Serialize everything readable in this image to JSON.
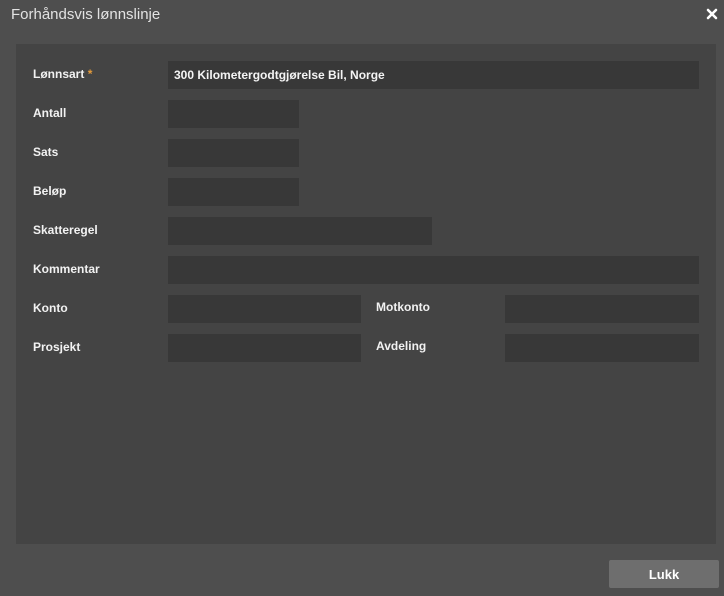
{
  "dialog": {
    "title": "Forhåndsvis lønnslinje",
    "close_icon": "close-icon",
    "close_button_label": "Lukk"
  },
  "form": {
    "lonnsart": {
      "label": "Lønnsart",
      "required_marker": "*",
      "value": "300 Kilometergodtgjørelse Bil, Norge"
    },
    "antall": {
      "label": "Antall",
      "value": ""
    },
    "sats": {
      "label": "Sats",
      "value": ""
    },
    "belop": {
      "label": "Beløp",
      "value": ""
    },
    "skatteregel": {
      "label": "Skatteregel",
      "value": ""
    },
    "kommentar": {
      "label": "Kommentar",
      "value": ""
    },
    "konto": {
      "label": "Konto",
      "value": ""
    },
    "motkonto": {
      "label": "Motkonto",
      "value": ""
    },
    "prosjekt": {
      "label": "Prosjekt",
      "value": ""
    },
    "avdeling": {
      "label": "Avdeling",
      "value": ""
    }
  },
  "colors": {
    "background": "#4e4e4e",
    "panel": "#444444",
    "field": "#383838",
    "required": "#e39a3a",
    "button": "#6e6e6e"
  }
}
